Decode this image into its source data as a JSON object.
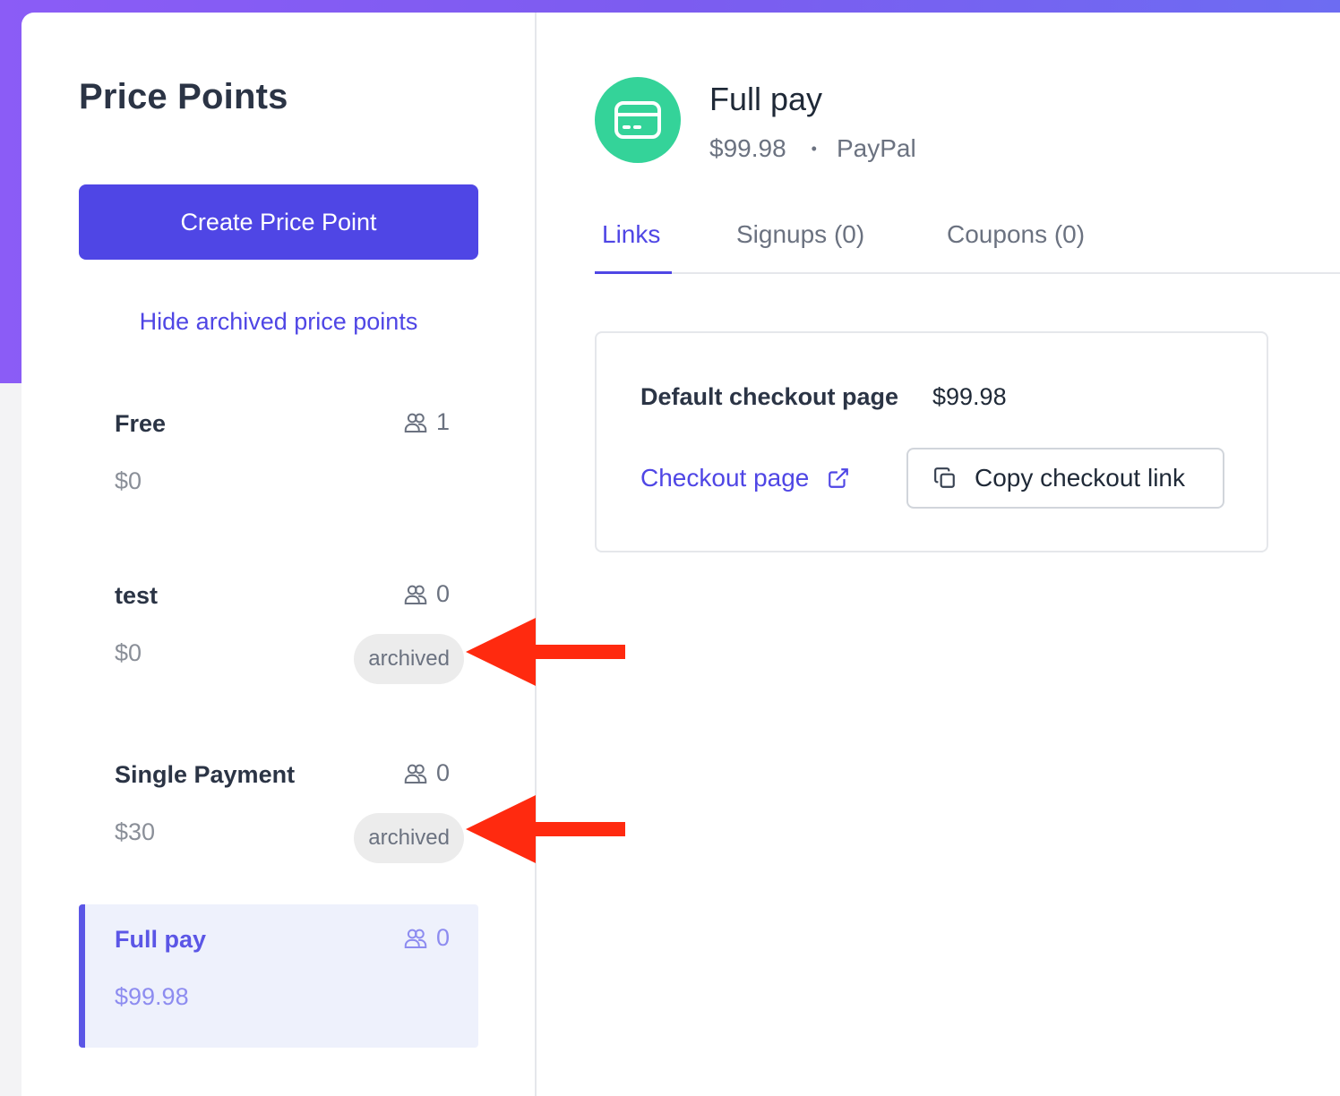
{
  "sidebar": {
    "title": "Price Points",
    "create_button": "Create Price Point",
    "hide_archived_link": "Hide archived price points",
    "items": [
      {
        "name": "Free",
        "price": "$0",
        "count": "1",
        "badge": ""
      },
      {
        "name": "test",
        "price": "$0",
        "count": "0",
        "badge": "archived"
      },
      {
        "name": "Single Payment",
        "price": "$30",
        "count": "0",
        "badge": "archived"
      },
      {
        "name": "Full pay",
        "price": "$99.98",
        "count": "0",
        "badge": ""
      }
    ]
  },
  "detail": {
    "title": "Full pay",
    "price": "$99.98",
    "separator": "•",
    "provider": "PayPal",
    "icon": "credit-card-icon"
  },
  "tabs": [
    {
      "label": "Links",
      "active": true
    },
    {
      "label": "Signups (0)",
      "active": false
    },
    {
      "label": "Coupons (0)",
      "active": false
    }
  ],
  "links_card": {
    "title": "Default checkout page",
    "price": "$99.98",
    "checkout_link": "Checkout page",
    "copy_button": "Copy checkout link"
  },
  "colors": {
    "accent": "#4f46e5",
    "icon_bg": "#34d399",
    "annotation_arrow": "#ff2a0f",
    "header_gradient": "#8b5cf6"
  }
}
